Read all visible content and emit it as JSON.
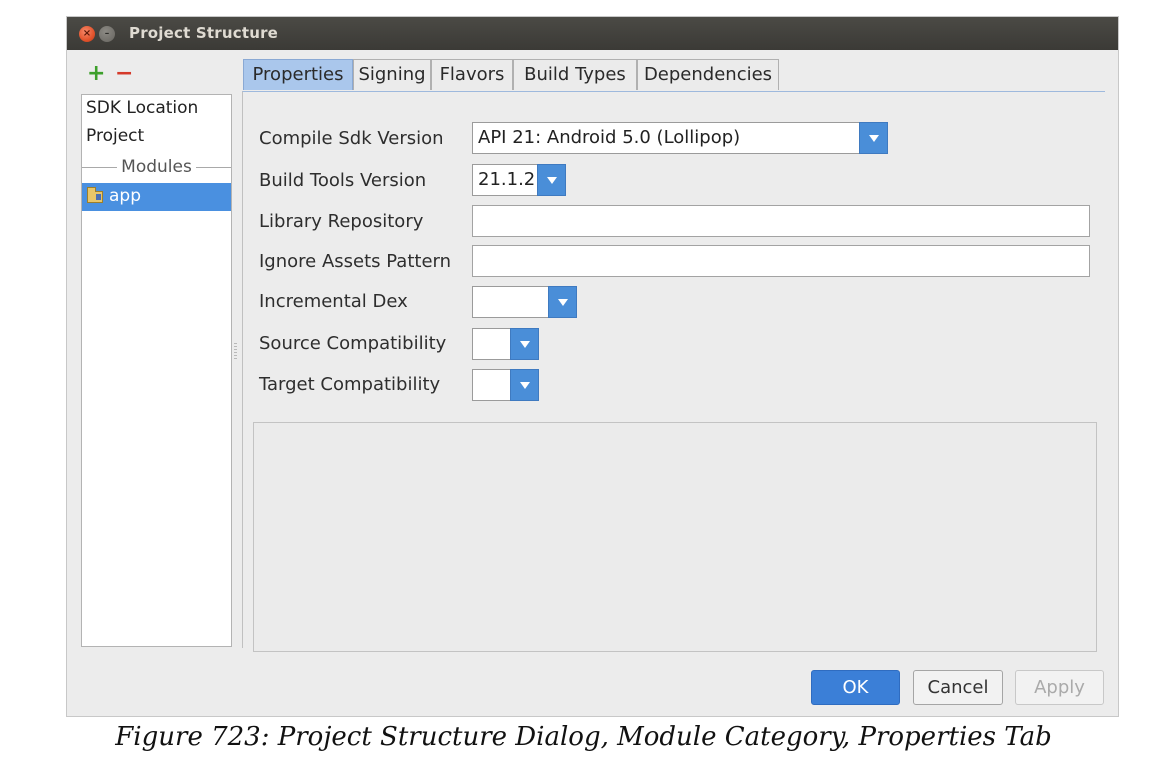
{
  "window": {
    "title": "Project Structure",
    "close_glyph": "×",
    "minimize_glyph": "–"
  },
  "toolbar": {
    "add": "+",
    "remove": "−"
  },
  "sidebar": {
    "items": [
      "SDK Location",
      "Project"
    ],
    "section": "Modules",
    "modules": [
      {
        "label": "app",
        "icon": "module-folder-icon",
        "selected": true
      }
    ]
  },
  "tabs": [
    {
      "label": "Properties",
      "active": true
    },
    {
      "label": "Signing",
      "active": false
    },
    {
      "label": "Flavors",
      "active": false
    },
    {
      "label": "Build Types",
      "active": false
    },
    {
      "label": "Dependencies",
      "active": false
    }
  ],
  "properties": {
    "compile_sdk": {
      "label": "Compile Sdk Version",
      "value": "API 21: Android 5.0 (Lollipop)"
    },
    "build_tools": {
      "label": "Build Tools Version",
      "value": "21.1.2"
    },
    "library_repository": {
      "label": "Library Repository",
      "value": ""
    },
    "ignore_assets": {
      "label": "Ignore Assets Pattern",
      "value": ""
    },
    "incremental_dex": {
      "label": "Incremental Dex",
      "value": ""
    },
    "source_compat": {
      "label": "Source Compatibility",
      "value": ""
    },
    "target_compat": {
      "label": "Target Compatibility",
      "value": ""
    }
  },
  "buttons": {
    "ok": "OK",
    "cancel": "Cancel",
    "apply": "Apply"
  },
  "caption": "Figure 723: Project Structure Dialog, Module Category, Properties Tab",
  "colors": {
    "accent": "#4a8ed8",
    "selection": "#4a90e0",
    "active_tab": "#aac7ec",
    "titlebar": "#3f3e3a"
  }
}
